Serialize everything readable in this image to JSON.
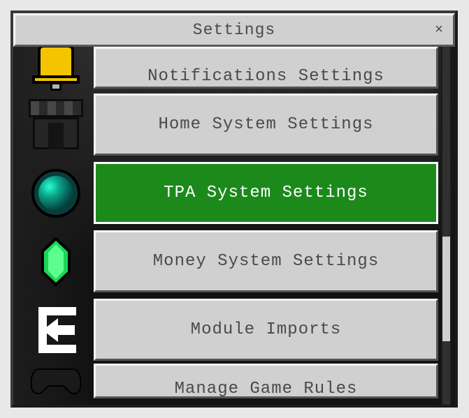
{
  "window": {
    "title": "Settings",
    "close_glyph": "×"
  },
  "menu": [
    {
      "label": "Notifications Settings",
      "icon": "bell-icon",
      "selected": false
    },
    {
      "label": "Home System Settings",
      "icon": "shop-icon",
      "selected": false
    },
    {
      "label": "TPA System Settings",
      "icon": "ender-pearl-icon",
      "selected": true
    },
    {
      "label": "Money System Settings",
      "icon": "emerald-icon",
      "selected": false
    },
    {
      "label": "Module Imports",
      "icon": "import-arrow-icon",
      "selected": false
    },
    {
      "label": "Manage Game Rules",
      "icon": "gamepad-icon",
      "selected": false
    }
  ],
  "colors": {
    "selected_bg": "#1b8a1b",
    "button_bg": "#d0d0d0"
  }
}
